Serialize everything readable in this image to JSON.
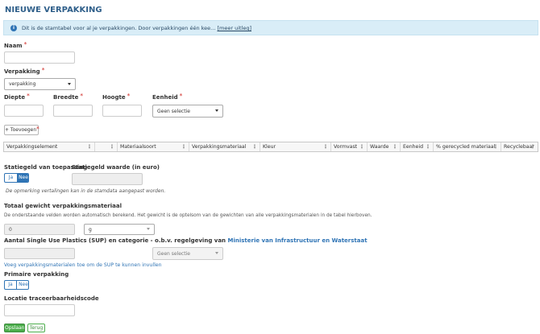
{
  "page": {
    "title": "NIEUWE VERPAKKING"
  },
  "info": {
    "icon": "info-icon",
    "text": "Dit is de stamtabel voor al je verpakkingen. Door verpakkingen één kee...",
    "link": "[meer uitleg]"
  },
  "form": {
    "naam_label": "Naam",
    "verpakking_label": "Verpakking",
    "verpakking_value": "verpakking",
    "diepte_label": "Diepte",
    "breedte_label": "Breedte",
    "hoogte_label": "Hoogte",
    "eenheid_label": "Eenheid",
    "eenheid_value": "Geen selectie",
    "required_mark": "*",
    "add_button": "+ Toevoegen",
    "add_required": "*"
  },
  "table": {
    "menu_glyph": "⋮",
    "columns": [
      "Verpakkingselement",
      "",
      "Materiaalsoort",
      "Verpakkingsmateriaal",
      "Kleur",
      "Vormvast",
      "Waarde",
      "Eenheid",
      "% gerecycled materiaal",
      "Recyclebaar"
    ]
  },
  "statiegeld": {
    "toggle_label": "Statiegeld van toepassing",
    "value_label": "Statiegeld waarde (in euro)",
    "ja": "Ja",
    "nee": "Nee",
    "selected": "Nee",
    "note": "De opmerking vertalingen kan in de stamdata aangepast worden."
  },
  "gewicht": {
    "label": "Totaal gewicht verpakkingsmateriaal",
    "note": "De onderstaande velden worden automatisch berekend. Het gewicht is de optelsom van de gewichten van alle verpakkingsmaterialen in de tabel hierboven.",
    "value": "0",
    "unit": "g"
  },
  "sup": {
    "label_start": "Aantal Single Use Plastics (SUP) en categorie - o.b.v. regelgeving van",
    "label_link": "Ministerie van Infrastructuur en Waterstaat",
    "select_value": "Geen selectie",
    "hint": "Voeg verpakkingsmaterialen toe om de SUP te kunnen invullen"
  },
  "primaire": {
    "label": "Primaire verpakking",
    "ja": "Ja",
    "nee": "Nee"
  },
  "locatie": {
    "label": "Locatie traceerbaarheidscode"
  },
  "actions": {
    "save": "Opslaan",
    "back": "Terug"
  },
  "colors": {
    "primary": "#2f74b5",
    "info_bg": "#d9edf7",
    "required": "#d9534f",
    "save": "#4cae4c"
  }
}
